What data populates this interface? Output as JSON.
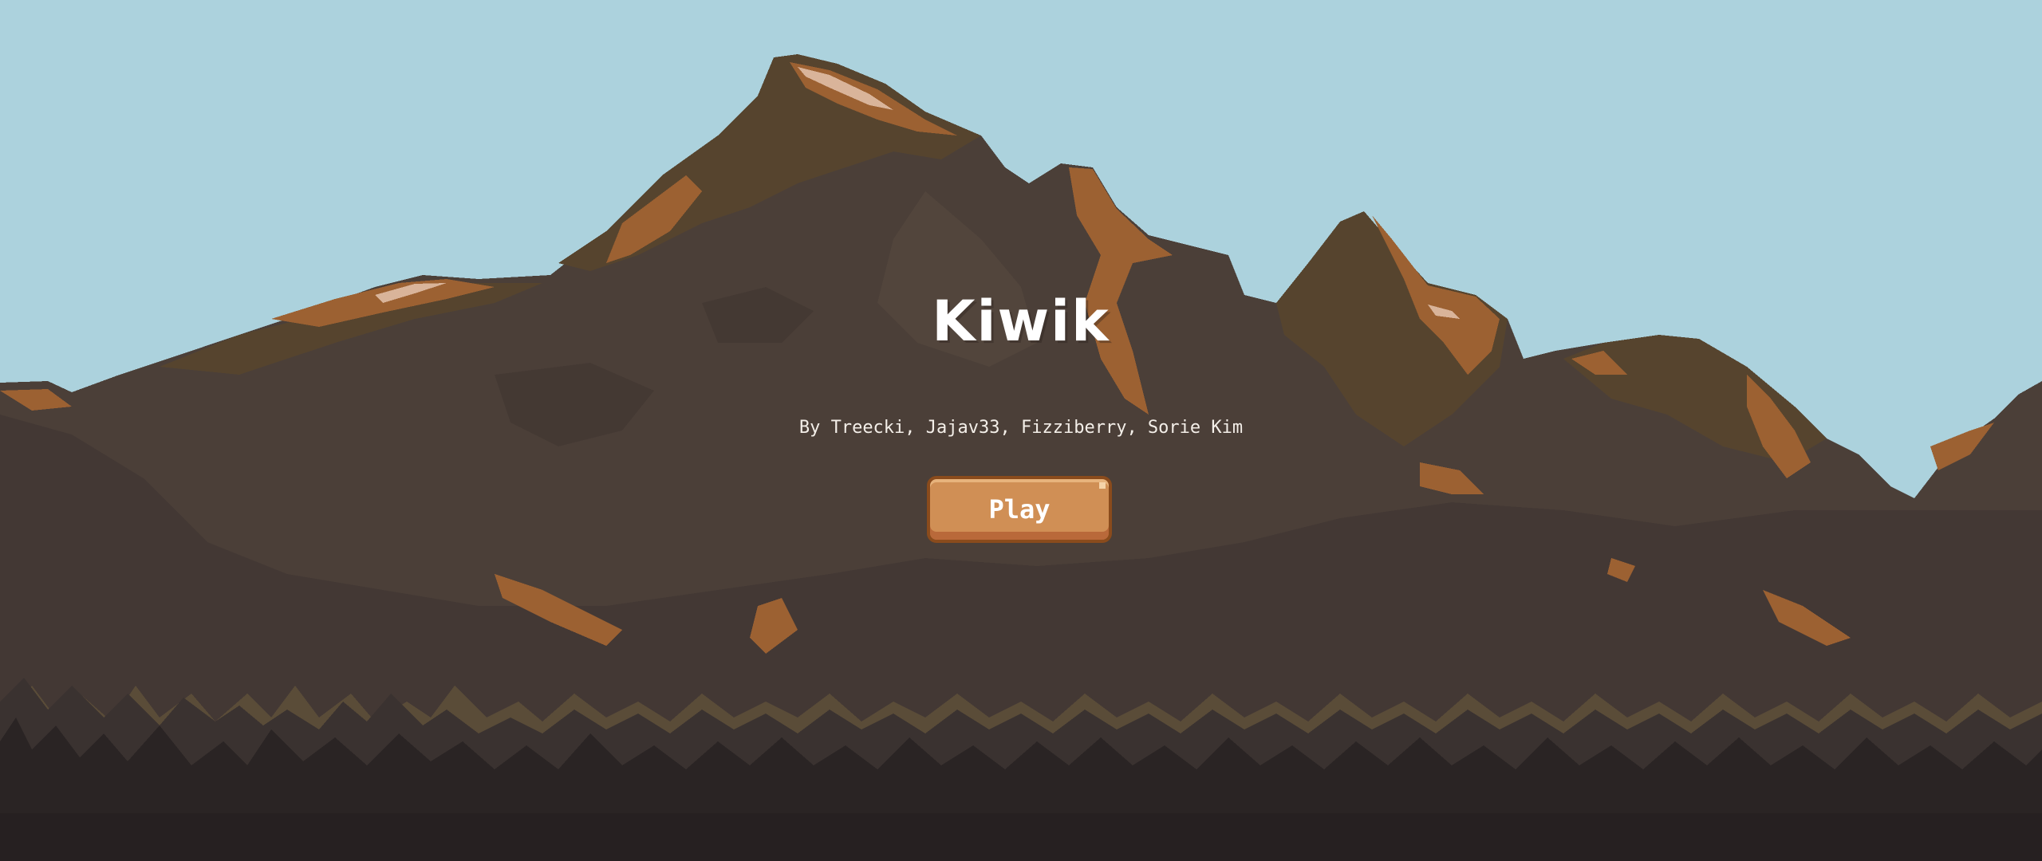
{
  "game": {
    "title": "Kiwik",
    "credits": "By Treecki, Jajav33, Fizziberry, Sorie Kim",
    "play_label": "Play"
  },
  "colors": {
    "sky": "#acd2dd",
    "mountain_dark": "#4b3f38",
    "mountain_mid": "#56442e",
    "mountain_highlight": "#9c6132",
    "forest_far": "#5a4c38",
    "forest_near": "#2a2424",
    "button": "#d08f55",
    "button_border": "#8a4b1c"
  }
}
